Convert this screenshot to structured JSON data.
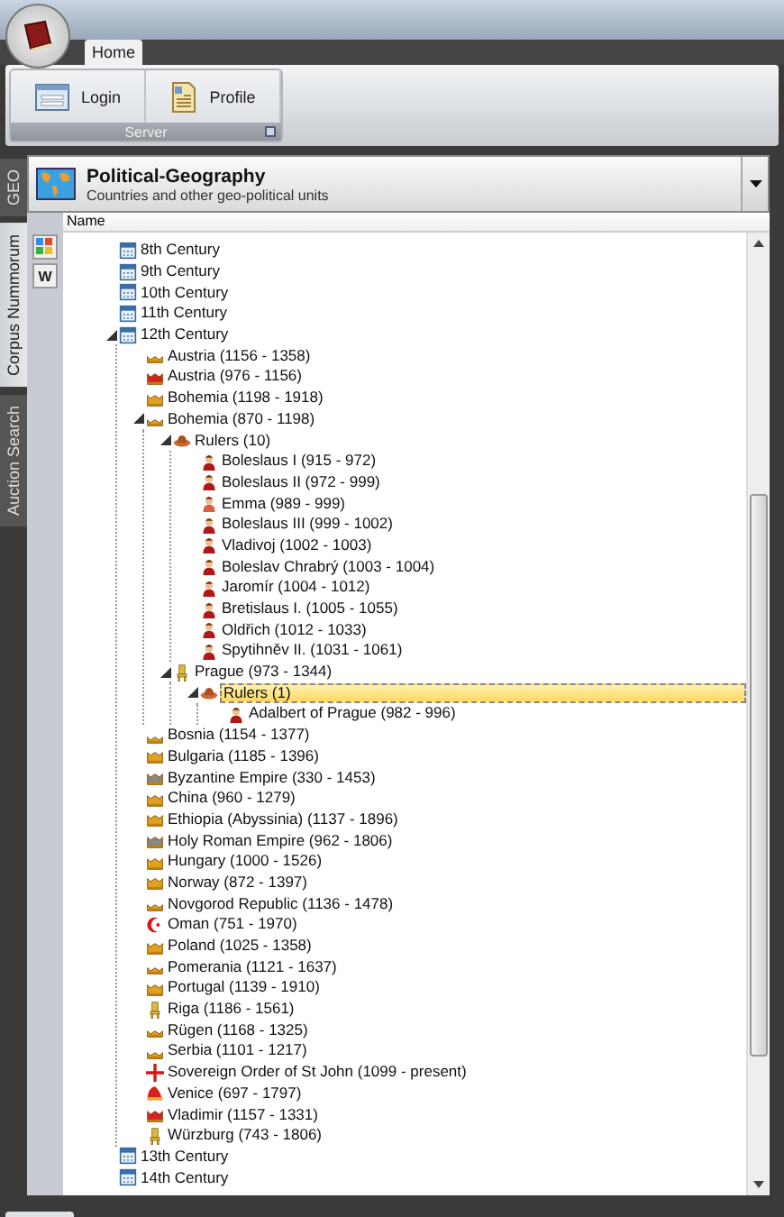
{
  "ribbon": {
    "tabs": [
      {
        "label": "Home",
        "selected": true
      }
    ],
    "groups": [
      {
        "label": "Server",
        "buttons": [
          {
            "label": "Login",
            "kind": "login"
          },
          {
            "label": "Profile",
            "kind": "profile"
          }
        ]
      }
    ]
  },
  "side_tabs": [
    {
      "label": "GEO",
      "selected": false
    },
    {
      "label": "Corpus Nummorum",
      "selected": true
    },
    {
      "label": "Auction Search",
      "selected": false
    }
  ],
  "selector": {
    "title": "Political-Geography",
    "subtitle": "Countries and other geo-political units"
  },
  "tool_strip": {
    "word_button": "W"
  },
  "tree": {
    "column": "Name",
    "nodes": [
      {
        "label": "8th Century",
        "kind": "calendar",
        "selected": false
      },
      {
        "label": "9th Century",
        "kind": "calendar",
        "selected": false
      },
      {
        "label": "10th Century",
        "kind": "calendar",
        "selected": false
      },
      {
        "label": "11th Century",
        "kind": "calendar",
        "selected": false
      },
      {
        "label": "12th Century",
        "kind": "calendar",
        "selected": false,
        "expanded": true,
        "children": [
          {
            "label": "Austria (1156 - 1358)",
            "kind": "crown-flat",
            "selected": false
          },
          {
            "label": "Austria (976 - 1156)",
            "kind": "crown-red",
            "selected": false
          },
          {
            "label": "Bohemia (1198 - 1918)",
            "kind": "crown",
            "selected": false
          },
          {
            "label": "Bohemia (870 - 1198)",
            "kind": "crown-flat",
            "selected": false,
            "expanded": true,
            "children": [
              {
                "label": "Rulers (10)",
                "kind": "hat",
                "selected": false,
                "expanded": true,
                "children": [
                  {
                    "label": "Boleslaus I (915 - 972)",
                    "kind": "person",
                    "selected": false
                  },
                  {
                    "label": "Boleslaus II (972 - 999)",
                    "kind": "person",
                    "selected": false
                  },
                  {
                    "label": "Emma (989 - 999)",
                    "kind": "person-light",
                    "selected": false
                  },
                  {
                    "label": "Boleslaus III (999 - 1002)",
                    "kind": "person",
                    "selected": false
                  },
                  {
                    "label": "Vladivoj (1002 - 1003)",
                    "kind": "person",
                    "selected": false
                  },
                  {
                    "label": "Boleslav Chrabrý (1003 - 1004)",
                    "kind": "person",
                    "selected": false
                  },
                  {
                    "label": "Jaromír (1004 - 1012)",
                    "kind": "person",
                    "selected": false
                  },
                  {
                    "label": "Bretislaus I. (1005 - 1055)",
                    "kind": "person",
                    "selected": false
                  },
                  {
                    "label": "Oldřich (1012 - 1033)",
                    "kind": "person",
                    "selected": false
                  },
                  {
                    "label": "Spytihněv II. (1031 - 1061)",
                    "kind": "person",
                    "selected": false
                  }
                ]
              },
              {
                "label": "Prague (973 - 1344)",
                "kind": "throne",
                "selected": false,
                "expanded": true,
                "children": [
                  {
                    "label": "Rulers (1)",
                    "kind": "hat",
                    "selected": true,
                    "expanded": true,
                    "children": [
                      {
                        "label": "Adalbert of Prague (982 - 996)",
                        "kind": "person",
                        "selected": false
                      }
                    ]
                  }
                ]
              }
            ]
          },
          {
            "label": "Bosnia (1154 - 1377)",
            "kind": "crown-flat",
            "selected": false
          },
          {
            "label": "Bulgaria (1185 - 1396)",
            "kind": "crown",
            "selected": false
          },
          {
            "label": "Byzantine Empire (330 - 1453)",
            "kind": "crown-grey",
            "selected": false
          },
          {
            "label": "China (960 - 1279)",
            "kind": "crown",
            "selected": false
          },
          {
            "label": "Ethiopia (Abyssinia) (1137 - 1896)",
            "kind": "crown",
            "selected": false
          },
          {
            "label": "Holy Roman Empire (962 - 1806)",
            "kind": "crown-grey",
            "selected": false
          },
          {
            "label": "Hungary (1000 - 1526)",
            "kind": "crown",
            "selected": false
          },
          {
            "label": "Norway (872 - 1397)",
            "kind": "crown",
            "selected": false
          },
          {
            "label": "Novgorod Republic (1136 - 1478)",
            "kind": "crown-flat",
            "selected": false
          },
          {
            "label": "Oman (751 - 1970)",
            "kind": "crescent",
            "selected": false
          },
          {
            "label": "Poland (1025 - 1358)",
            "kind": "crown",
            "selected": false
          },
          {
            "label": "Pomerania (1121 - 1637)",
            "kind": "crown-flat",
            "selected": false
          },
          {
            "label": "Portugal (1139 - 1910)",
            "kind": "crown",
            "selected": false
          },
          {
            "label": "Riga (1186 - 1561)",
            "kind": "throne",
            "selected": false
          },
          {
            "label": "Rügen (1168 - 1325)",
            "kind": "crown-flat",
            "selected": false
          },
          {
            "label": "Serbia (1101 - 1217)",
            "kind": "crown-flat",
            "selected": false
          },
          {
            "label": "Sovereign Order of St John (1099 - present)",
            "kind": "cross",
            "selected": false
          },
          {
            "label": "Venice (697 - 1797)",
            "kind": "cap",
            "selected": false
          },
          {
            "label": "Vladimir (1157 - 1331)",
            "kind": "crown-red",
            "selected": false
          },
          {
            "label": "Würzburg (743 - 1806)",
            "kind": "throne",
            "selected": false
          }
        ]
      },
      {
        "label": "13th Century",
        "kind": "calendar",
        "selected": false
      },
      {
        "label": "14th Century",
        "kind": "calendar",
        "selected": false
      }
    ]
  }
}
